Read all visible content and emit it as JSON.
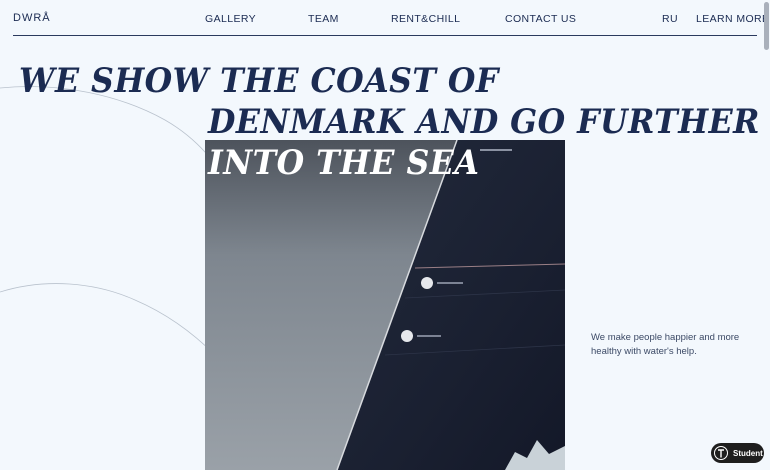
{
  "header": {
    "logo": "DWRÅ",
    "nav": [
      "GALLERY",
      "TEAM",
      "RENT&CHILL",
      "CONTACT US"
    ],
    "language": "RU",
    "learn_more": "LEARN MORE"
  },
  "hero": {
    "headline_lines": [
      "WE SHOW THE COAST OF",
      "DENMARK AND GO FURTHER",
      "INTO THE SEA"
    ],
    "tagline": "We make people happier and more healthy with water's help."
  },
  "badge": {
    "label": "Student",
    "icon": "tumblr-t-icon"
  },
  "colors": {
    "background": "#f3f8fd",
    "text": "#1b2b52",
    "sail": "#1c2336",
    "sky": "#8c949c"
  }
}
